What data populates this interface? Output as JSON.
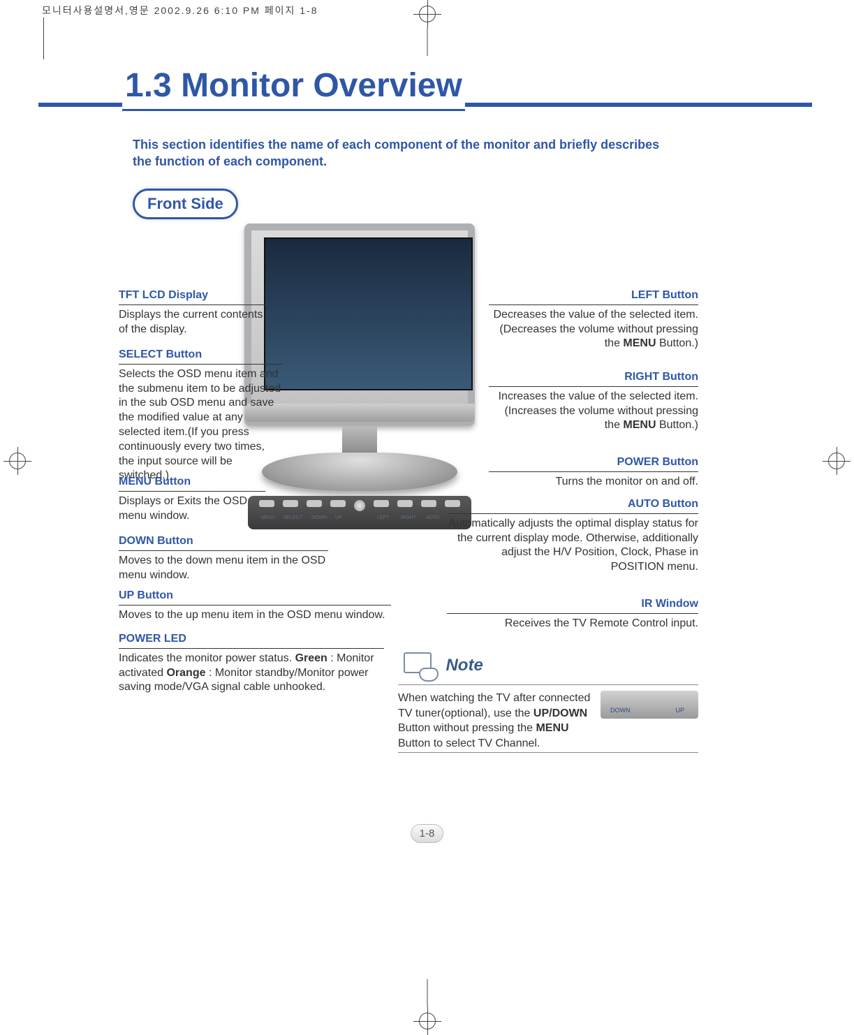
{
  "prepress_header": "모니터사용설명서,영문  2002.9.26 6:10 PM  페이지 1-8",
  "title": "1.3  Monitor Overview",
  "intro": "This section identifies the name of each component of the monitor and briefly describes the function of each component.",
  "section_pill": "Front Side",
  "page_number": "1-8",
  "button_labels": {
    "menu": "MENU",
    "select": "SELECT",
    "down": "DOWN",
    "up": "UP",
    "left": "LEFT",
    "right": "RIGHT",
    "auto": "AUTO"
  },
  "callouts_left": [
    {
      "hd": "TFT LCD Display",
      "bd": "Displays the current contents of the display."
    },
    {
      "hd": "SELECT Button",
      "bd": "Selects the OSD menu item and the submenu item to be adjusted in the sub OSD menu and save the modified value at any selected item.(If you press continuously every two times, the input source will be switched.)"
    },
    {
      "hd": "MENU Button",
      "bd": "Displays or Exits the OSD menu window."
    },
    {
      "hd": "DOWN Button",
      "bd": "Moves to the down menu item in the OSD menu window."
    },
    {
      "hd": "UP Button",
      "bd": "Moves to the up menu item in the OSD menu window."
    },
    {
      "hd": "POWER LED",
      "bd_pre": "Indicates the monitor power status. ",
      "b1": "Green",
      "mid1": " : Monitor activated  ",
      "b2": "Orange",
      "mid2": " : Monitor standby/Monitor power saving mode/VGA signal cable unhooked."
    }
  ],
  "callouts_right": [
    {
      "hd": "LEFT Button",
      "bd_pre": "Decreases the value of the selected item. (Decreases the volume without pressing the ",
      "b": "MENU",
      "bd_post": " Button.)"
    },
    {
      "hd": "RIGHT Button",
      "bd_pre": "Increases the value of the selected item. (Increases the volume without pressing the ",
      "b": "MENU",
      "bd_post": " Button.)"
    },
    {
      "hd": "POWER Button",
      "bd": "Turns the monitor on and off."
    },
    {
      "hd": "AUTO Button",
      "bd": "Automatically adjusts the optimal display status for the current display mode. Otherwise, additionally adjust the H/V Position, Clock, Phase in POSITION menu."
    },
    {
      "hd": "IR Window",
      "bd": "Receives the TV Remote Control input."
    }
  ],
  "note": {
    "title": "Note",
    "dn_label": "DOWN",
    "up_label": "UP",
    "pre": "When watching the TV after connected TV tuner(optional), use the ",
    "b1": "UP/DOWN",
    "mid": " Button without pressing the ",
    "b2": "MENU",
    "post": " Button to select TV Channel."
  }
}
